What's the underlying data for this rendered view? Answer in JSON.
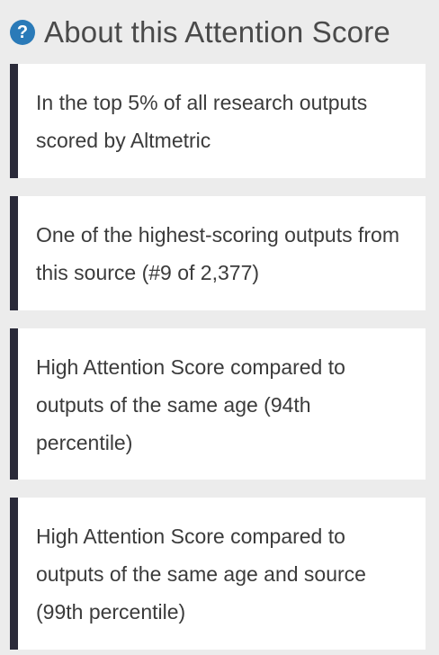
{
  "header": {
    "icon": "question-circle-icon",
    "icon_glyph": "?",
    "title": "About this Attention Score"
  },
  "cards": [
    {
      "text": "In the top 5% of all research outputs scored by Altmetric"
    },
    {
      "text": "One of the highest-scoring outputs from this source (#9 of 2,377)"
    },
    {
      "text": "High Attention Score compared to outputs of the same age (94th percentile)"
    },
    {
      "text": "High Attention Score compared to outputs of the same age and source (99th percentile)"
    }
  ],
  "colors": {
    "background": "#ececec",
    "card": "#ffffff",
    "card_accent": "#2b2b3a",
    "icon": "#2a7ab8",
    "text": "#3b3b3b"
  }
}
